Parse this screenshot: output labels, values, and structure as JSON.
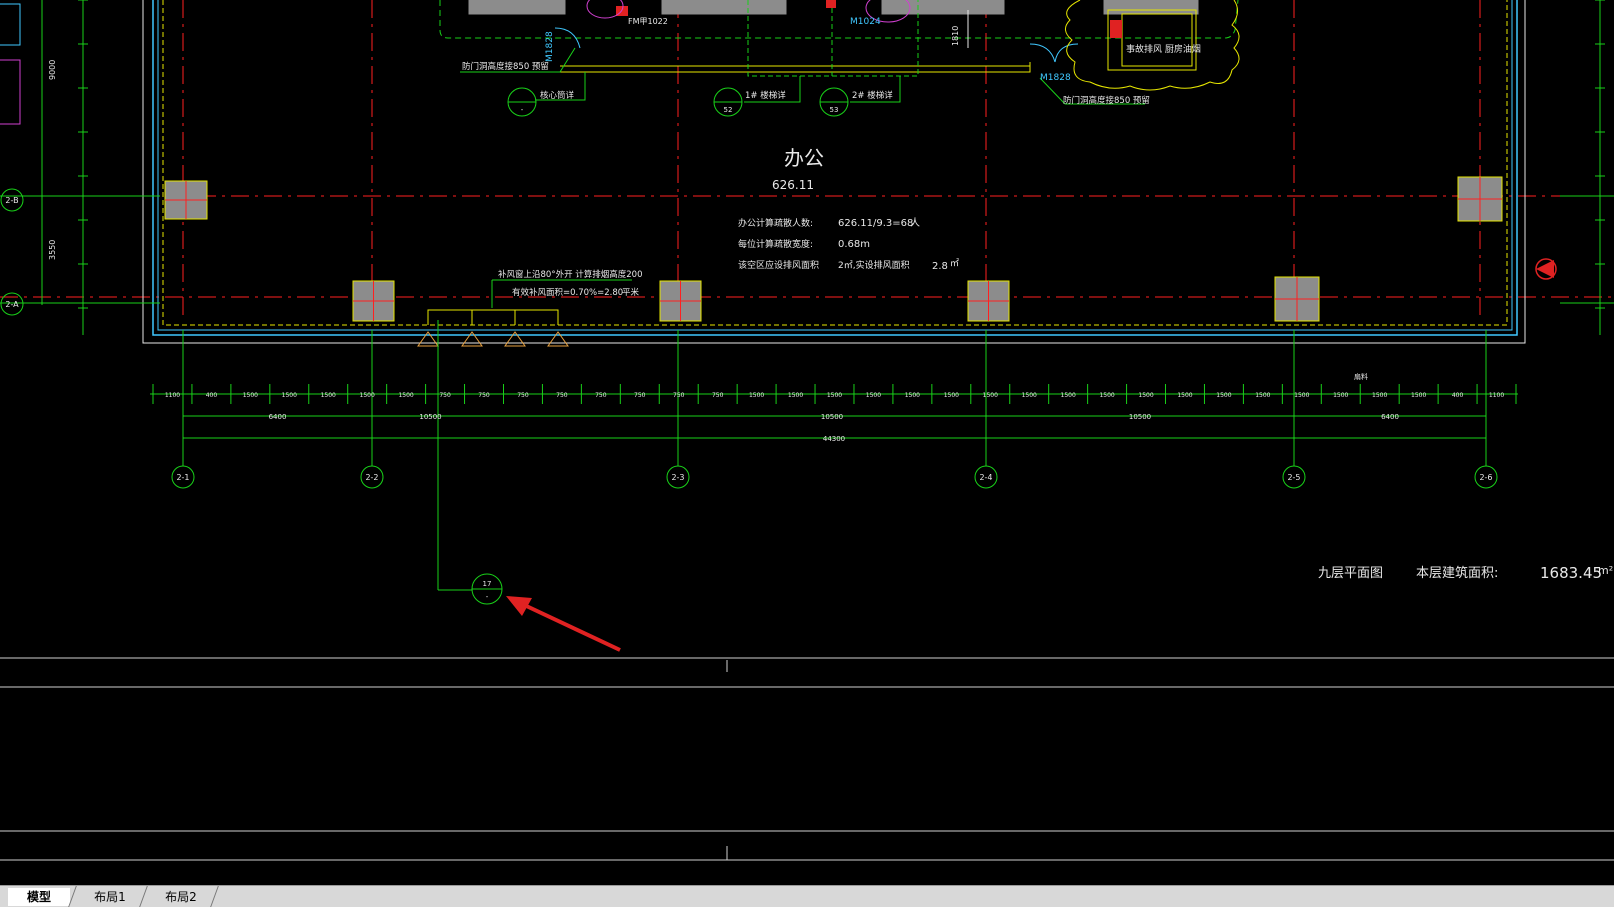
{
  "drawing": {
    "room_label": "办公",
    "room_area": "626.11",
    "calc_people_label": "办公计算疏散人数:",
    "calc_people_value": "626.11/9.3=68",
    "calc_people_unit": "人",
    "exit_width_label": "每位计算疏散宽度:",
    "exit_width_value": "0.68m",
    "smoke_label": "该空区应设排风面积",
    "smoke_value": "2㎡,实设排风面积",
    "smoke_actual": "2.8",
    "smoke_unit": "㎡",
    "vent_note_1": "补风窗上沿80°外开 计算排烟高度200",
    "vent_note_2": "有效补风面积=0.70%=2.80",
    "vent_note_2_unit": "平米",
    "door_note_left": "防门洞高度接850 预留",
    "door_note_right": "防门洞高度接850 预留",
    "core_detail_label": "核心筒详",
    "stair1_label": "1# 楼梯详",
    "stair2_label": "2# 楼梯详",
    "core_detail_ref": "-",
    "stair1_ref": "52",
    "stair2_ref": "53",
    "equip_note": "事故排风 厨房油烟",
    "door_tags": [
      "M1828",
      "M1828",
      "M1024",
      "FM甲1022"
    ],
    "dim_1810": "1810",
    "left_dims": [
      "9000",
      "3550"
    ],
    "grid_axes_bottom": [
      "2-1",
      "2-2",
      "2-3",
      "2-4",
      "2-5",
      "2-6"
    ],
    "grid_axes_left": [
      "2-B",
      "2-A"
    ],
    "dim_row1": [
      "1100",
      "400",
      "1500",
      "1500",
      "1500",
      "1500",
      "1500",
      "750",
      "750",
      "750",
      "750",
      "750",
      "750",
      "750",
      "750",
      "1500",
      "1500",
      "1500",
      "1500",
      "1500",
      "1500",
      "1500",
      "1500",
      "1500",
      "1500",
      "1500",
      "1500",
      "1500",
      "1500",
      "1500",
      "1500",
      "1500",
      "1500",
      "400",
      "1100"
    ],
    "dim_row2": [
      "6400",
      "10500",
      "10500",
      "10500",
      "6400"
    ],
    "dim_total": "44300",
    "callout_top": "17",
    "callout_bottom": "-",
    "floor_title": "九层平面图",
    "floor_area_label": "本层建筑面积:",
    "floor_area_value": "1683.45",
    "floor_area_unit": "m²",
    "material_note": "扇料"
  },
  "tabs": [
    "模型",
    "布局1",
    "布局2"
  ],
  "colors": {
    "background": "#000000",
    "grid_line": "#ff2020",
    "green": "#19d119",
    "yellow": "#e6e600",
    "cyan": "#40c8ff",
    "white": "#e8e8e8",
    "column_fill": "#8c8c8c",
    "arrow": "#e02222"
  }
}
